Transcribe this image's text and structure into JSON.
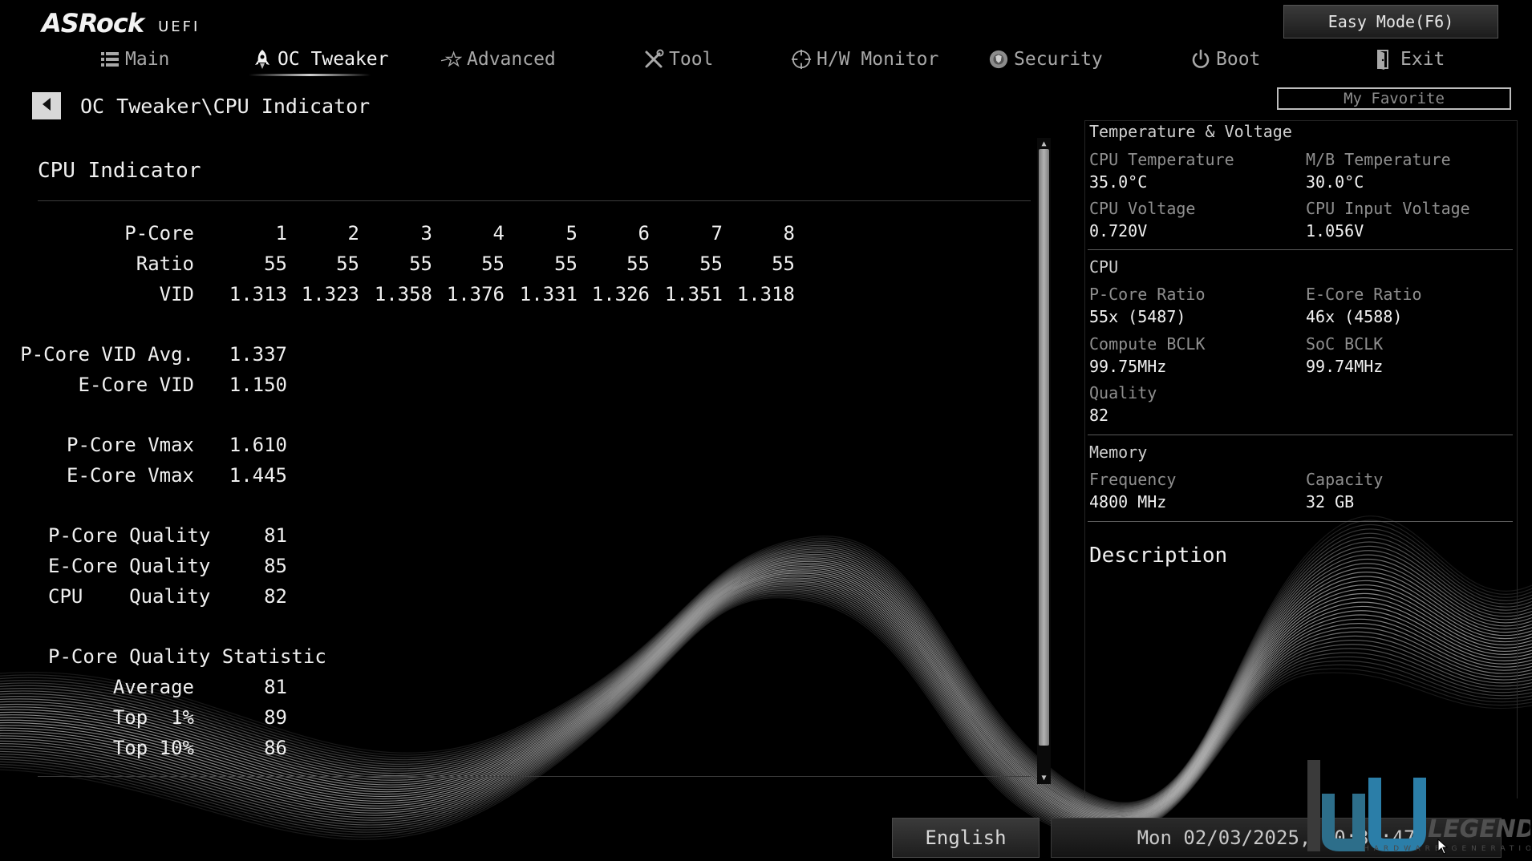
{
  "header": {
    "brand": "ASRock",
    "brand_sub": "UEFI",
    "easy_mode": "Easy Mode(F6)",
    "my_favorite": "My Favorite"
  },
  "nav": {
    "tabs": [
      {
        "label": "Main",
        "icon": "list-icon"
      },
      {
        "label": "OC Tweaker",
        "icon": "rocket-icon",
        "active": true
      },
      {
        "label": "Advanced",
        "icon": "star-icon"
      },
      {
        "label": "Tool",
        "icon": "tools-icon"
      },
      {
        "label": "H/W Monitor",
        "icon": "crosshair-icon"
      },
      {
        "label": "Security",
        "icon": "shield-icon"
      },
      {
        "label": "Boot",
        "icon": "power-icon"
      },
      {
        "label": "Exit",
        "icon": "exit-icon"
      }
    ]
  },
  "breadcrumb": "OC Tweaker\\CPU Indicator",
  "main": {
    "title": "CPU Indicator",
    "core_table": {
      "row_labels": [
        "P-Core",
        "Ratio",
        "VID"
      ],
      "cores": [
        "1",
        "2",
        "3",
        "4",
        "5",
        "6",
        "7",
        "8"
      ],
      "ratio": [
        "55",
        "55",
        "55",
        "55",
        "55",
        "55",
        "55",
        "55"
      ],
      "vid": [
        "1.313",
        "1.323",
        "1.358",
        "1.376",
        "1.331",
        "1.326",
        "1.351",
        "1.318"
      ]
    },
    "vid_summary": [
      {
        "label": "P-Core VID Avg.",
        "value": "1.337"
      },
      {
        "label": "E-Core VID",
        "value": "1.150"
      }
    ],
    "vmax": [
      {
        "label": "P-Core Vmax",
        "value": "1.610"
      },
      {
        "label": "E-Core Vmax",
        "value": "1.445"
      }
    ],
    "quality": [
      {
        "label": "P-Core Quality",
        "value": "81"
      },
      {
        "label": "E-Core Quality",
        "value": "85"
      },
      {
        "label": "CPU    Quality",
        "value": "82"
      }
    ],
    "stat_title": "P-Core Quality Statistic",
    "stats": [
      {
        "label": "Average",
        "value": "81"
      },
      {
        "label": "Top  1%",
        "value": "89"
      },
      {
        "label": "Top 10%",
        "value": "86"
      }
    ]
  },
  "right_panel": {
    "temp_voltage": {
      "heading": "Temperature & Voltage",
      "items": [
        {
          "label": "CPU Temperature",
          "value": "35.0°C"
        },
        {
          "label": "M/B Temperature",
          "value": "30.0°C"
        },
        {
          "label": "CPU Voltage",
          "value": "0.720V"
        },
        {
          "label": "CPU Input Voltage",
          "value": "1.056V"
        }
      ]
    },
    "cpu": {
      "heading": "CPU",
      "items": [
        {
          "label": "P-Core Ratio",
          "value": "55x (5487)"
        },
        {
          "label": "E-Core Ratio",
          "value": "46x (4588)"
        },
        {
          "label": "Compute BCLK",
          "value": "99.75MHz"
        },
        {
          "label": "SoC BCLK",
          "value": "99.74MHz"
        },
        {
          "label": "Quality",
          "value": "82"
        }
      ]
    },
    "memory": {
      "heading": "Memory",
      "items": [
        {
          "label": "Frequency",
          "value": "4800 MHz"
        },
        {
          "label": "Capacity",
          "value": "32 GB"
        }
      ]
    },
    "description_title": "Description"
  },
  "footer": {
    "language": "English",
    "datetime": "Mon 02/03/2025, 20:37:47"
  },
  "watermark": {
    "text": "LEGEND",
    "subtext": "HARDWARE GENERATION"
  },
  "colors": {
    "background": "#000000",
    "text": "#f0f0f0",
    "label_gray": "#8f8f8f"
  }
}
